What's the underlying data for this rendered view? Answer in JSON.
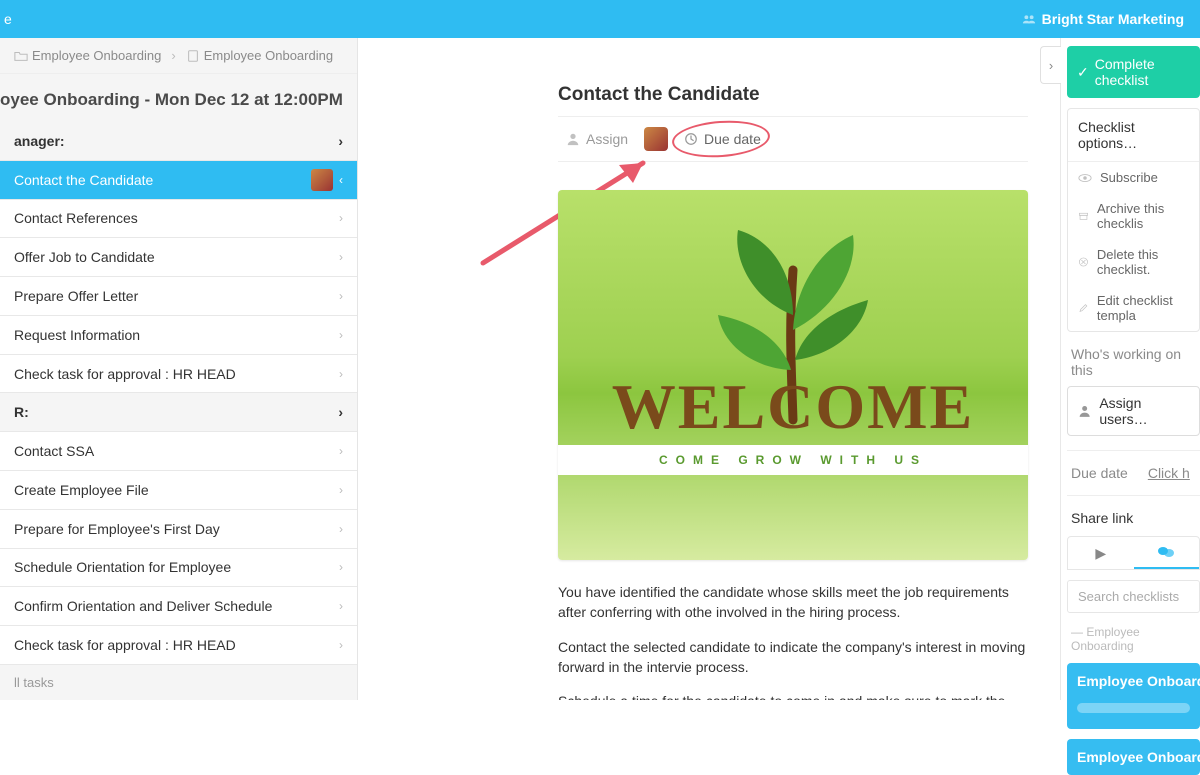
{
  "header": {
    "org": "Bright Star Marketing",
    "corner_text": "e"
  },
  "breadcrumb": {
    "a": "Employee Onboarding",
    "b": "Employee Onboarding"
  },
  "page_title": "oyee Onboarding - Mon Dec 12 at 12:00PM",
  "sections": {
    "a_head": "anager:",
    "a_items": [
      "Contact the Candidate",
      "Contact References",
      "Offer Job to Candidate",
      "Prepare Offer Letter",
      "Request Information",
      "Check task for approval : HR HEAD"
    ],
    "b_head": "R:",
    "b_items": [
      "Contact SSA",
      "Create Employee File",
      "Prepare for Employee's First Day",
      "Schedule Orientation for Employee",
      "Confirm Orientation and Deliver Schedule",
      "Check task for approval : HR HEAD"
    ]
  },
  "footer_link": "ll tasks",
  "task": {
    "title": "Contact the Candidate",
    "assign_label": "Assign",
    "due_label": "Due date",
    "welcome_big": "WELCOME",
    "welcome_sub": "COME GROW WITH US",
    "para1": "You have identified the candidate whose skills meet the job requirements after conferring with othe involved in the hiring process.",
    "para2": "Contact the selected candidate to indicate the company's interest in moving forward in the intervie process.",
    "para3": "Schedule a time for the candidate to come in and make sure to mark the date and time on the"
  },
  "right": {
    "complete": "Complete checklist",
    "options_head": "Checklist options…",
    "options": [
      "Subscribe",
      "Archive this checklis",
      "Delete this checklist.",
      "Edit checklist templa"
    ],
    "working_head": "Who's working on this",
    "assign_users": "Assign users…",
    "due_label": "Due date",
    "due_link": "Click h",
    "share_label": "Share link",
    "search_placeholder": "Search checklists",
    "group_label": "Employee Onboarding",
    "cl1": "Employee Onboardin",
    "cl2": "Employee Onboardin"
  }
}
